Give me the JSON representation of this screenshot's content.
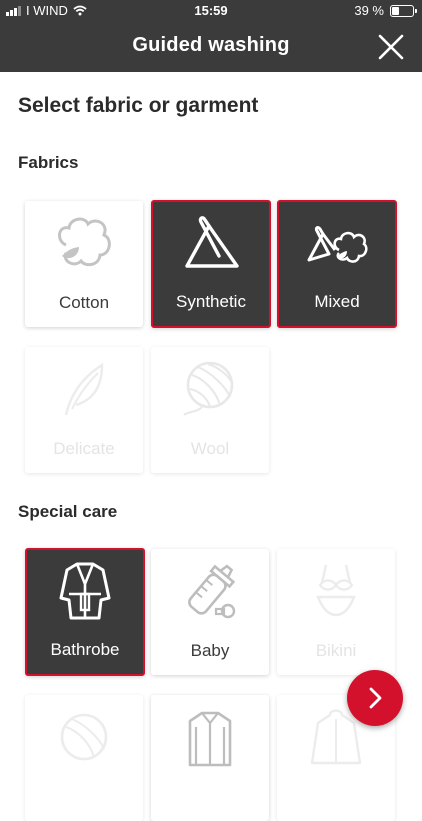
{
  "status_bar": {
    "carrier": "I WIND",
    "time": "15:59",
    "battery_text": "39 %",
    "battery_level": 0.39
  },
  "header": {
    "title": "Guided washing",
    "close_icon": "close-icon"
  },
  "page_heading": "Select fabric or garment",
  "sections": {
    "fabrics": {
      "heading": "Fabrics",
      "items": [
        {
          "label": "Cotton",
          "icon": "cotton-icon",
          "state": "available"
        },
        {
          "label": "Synthetic",
          "icon": "synthetic-icon",
          "state": "selected"
        },
        {
          "label": "Mixed",
          "icon": "mixed-icon",
          "state": "selected"
        },
        {
          "label": "Delicate",
          "icon": "feather-icon",
          "state": "disabled"
        },
        {
          "label": "Wool",
          "icon": "yarn-ball-icon",
          "state": "disabled"
        }
      ]
    },
    "special_care": {
      "heading": "Special care",
      "items": [
        {
          "label": "Bathrobe",
          "icon": "bathrobe-icon",
          "state": "selected"
        },
        {
          "label": "Baby",
          "icon": "baby-bottle-icon",
          "state": "available"
        },
        {
          "label": "Bikini",
          "icon": "bikini-icon",
          "state": "disabled"
        },
        {
          "label": "",
          "icon": "yarn-ball-icon",
          "state": "disabled"
        },
        {
          "label": "",
          "icon": "shirt-icon",
          "state": "available"
        },
        {
          "label": "",
          "icon": "jacket-icon",
          "state": "disabled"
        }
      ]
    }
  },
  "next_button": {
    "icon": "chevron-right-icon"
  },
  "colors": {
    "header_bg": "#3b3b3b",
    "accent": "#d3112c",
    "selected_card_bg": "#3b3b3b"
  }
}
